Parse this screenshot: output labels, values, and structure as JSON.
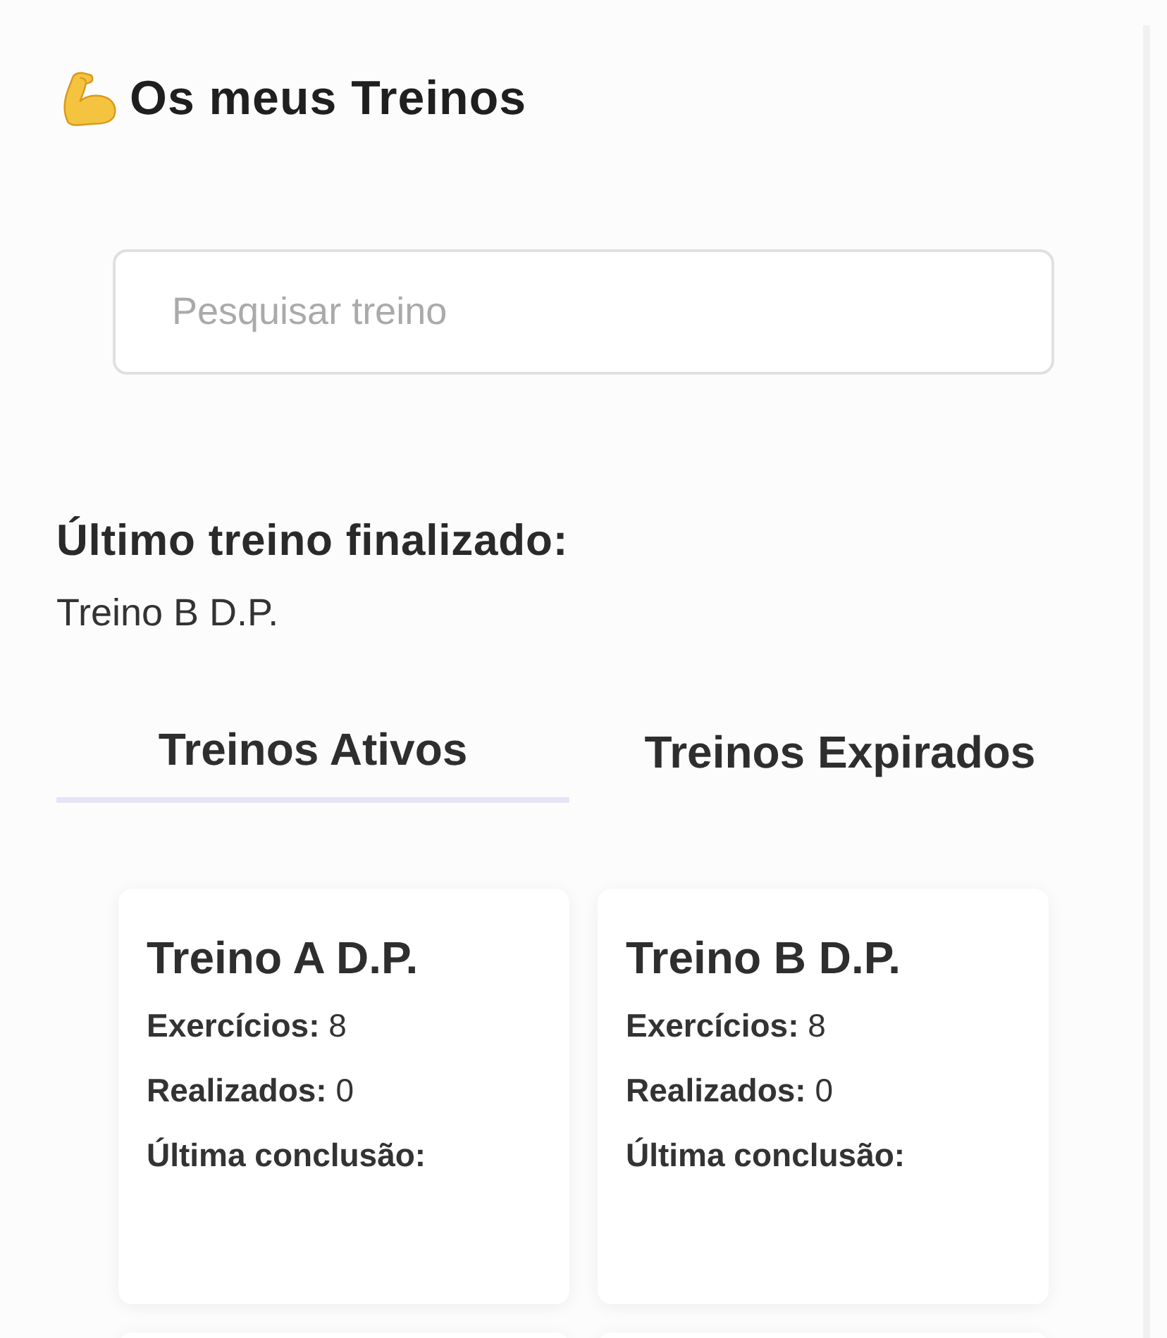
{
  "header": {
    "title": "Os meus Treinos"
  },
  "search": {
    "placeholder": "Pesquisar treino"
  },
  "last_workout": {
    "label": "Último treino finalizado:",
    "value": "Treino B D.P."
  },
  "tabs": [
    {
      "label": "Treinos Ativos",
      "selected": true
    },
    {
      "label": "Treinos Expirados",
      "selected": false
    }
  ],
  "cards": [
    {
      "kind": "full",
      "title": "Treino A D.P.",
      "fields": [
        {
          "label": "Exercícios:",
          "value": "8"
        },
        {
          "label": "Realizados:",
          "value": "0"
        },
        {
          "label": "Última conclusão:"
        }
      ]
    },
    {
      "kind": "full",
      "title": "Treino B D.P.",
      "fields": [
        {
          "label": "Exercícios:",
          "value": "8"
        },
        {
          "label": "Realizados:",
          "value": "0"
        },
        {
          "label": "Última conclusão:"
        }
      ]
    },
    {
      "kind": "partial"
    },
    {
      "kind": "partial"
    }
  ]
}
